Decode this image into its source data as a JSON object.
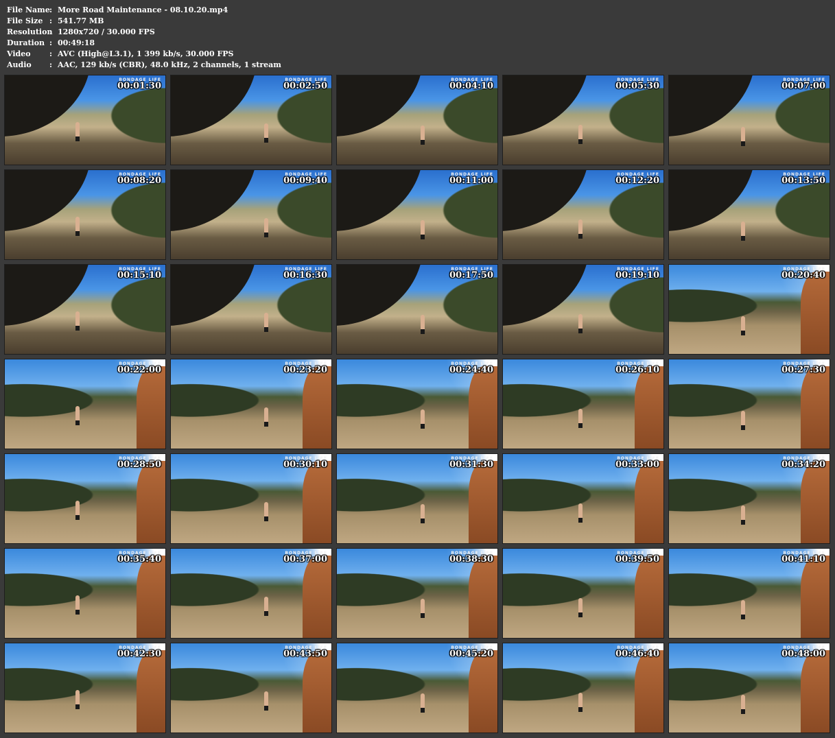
{
  "info": [
    {
      "label": "File Name",
      "value": "More Road Maintenance - 08.10.20.mp4"
    },
    {
      "label": "File Size",
      "value": "541.77 MB"
    },
    {
      "label": "Resolution",
      "value": "1280x720 / 30.000 FPS"
    },
    {
      "label": "Duration",
      "value": "00:49:18"
    },
    {
      "label": "Video",
      "value": "AVC (High@L3.1), 1 399 kb/s, 30.000 FPS"
    },
    {
      "label": "Audio",
      "value": "AAC, 129 kb/s (CBR), 48.0 kHz, 2 channels, 1 stream"
    }
  ],
  "separator": ":",
  "watermark": "BONDAGE LIFE",
  "thumbnails": [
    {
      "time": "00:01:30",
      "scene": "a"
    },
    {
      "time": "00:02:50",
      "scene": "a"
    },
    {
      "time": "00:04:10",
      "scene": "a"
    },
    {
      "time": "00:05:30",
      "scene": "a"
    },
    {
      "time": "00:07:00",
      "scene": "a"
    },
    {
      "time": "00:08:20",
      "scene": "a"
    },
    {
      "time": "00:09:40",
      "scene": "a"
    },
    {
      "time": "00:11:00",
      "scene": "a"
    },
    {
      "time": "00:12:20",
      "scene": "a"
    },
    {
      "time": "00:13:50",
      "scene": "a"
    },
    {
      "time": "00:15:10",
      "scene": "a"
    },
    {
      "time": "00:16:30",
      "scene": "a"
    },
    {
      "time": "00:17:50",
      "scene": "a"
    },
    {
      "time": "00:19:10",
      "scene": "a"
    },
    {
      "time": "00:20:40",
      "scene": "b"
    },
    {
      "time": "00:22:00",
      "scene": "b"
    },
    {
      "time": "00:23:20",
      "scene": "b"
    },
    {
      "time": "00:24:40",
      "scene": "b"
    },
    {
      "time": "00:26:10",
      "scene": "b"
    },
    {
      "time": "00:27:30",
      "scene": "b"
    },
    {
      "time": "00:28:50",
      "scene": "b"
    },
    {
      "time": "00:30:10",
      "scene": "b"
    },
    {
      "time": "00:31:30",
      "scene": "b"
    },
    {
      "time": "00:33:00",
      "scene": "b"
    },
    {
      "time": "00:34:20",
      "scene": "b"
    },
    {
      "time": "00:35:40",
      "scene": "b"
    },
    {
      "time": "00:37:00",
      "scene": "b"
    },
    {
      "time": "00:38:30",
      "scene": "b"
    },
    {
      "time": "00:39:50",
      "scene": "b"
    },
    {
      "time": "00:41:10",
      "scene": "b"
    },
    {
      "time": "00:42:30",
      "scene": "b"
    },
    {
      "time": "00:43:50",
      "scene": "b"
    },
    {
      "time": "00:45:20",
      "scene": "b"
    },
    {
      "time": "00:46:40",
      "scene": "b"
    },
    {
      "time": "00:48:00",
      "scene": "b"
    }
  ]
}
